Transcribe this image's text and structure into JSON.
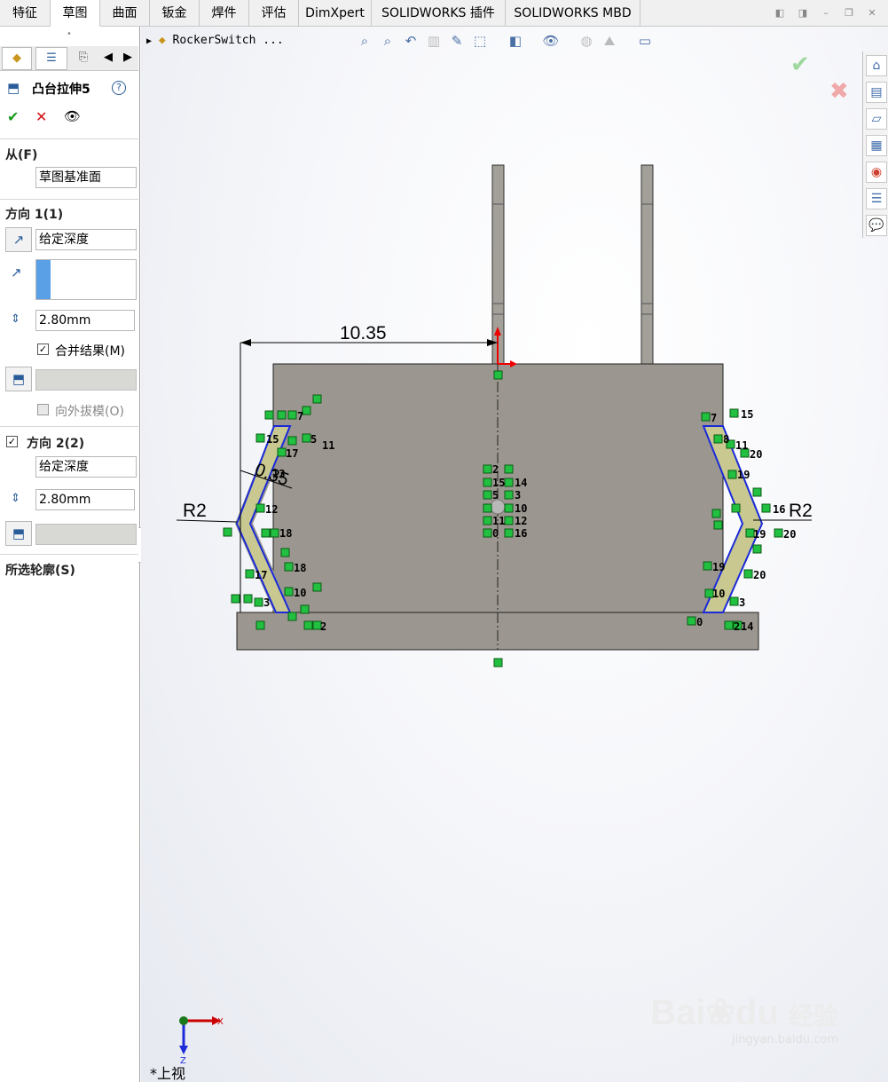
{
  "tabs": [
    {
      "label": "特征",
      "active": false
    },
    {
      "label": "草图",
      "active": true
    },
    {
      "label": "曲面",
      "active": false
    },
    {
      "label": "钣金",
      "active": false
    },
    {
      "label": "焊件",
      "active": false
    },
    {
      "label": "评估",
      "active": false
    },
    {
      "label": "DimXpert",
      "active": false
    },
    {
      "label": "SOLIDWORKS 插件",
      "active": false
    },
    {
      "label": "SOLIDWORKS MBD",
      "active": false
    }
  ],
  "feature": {
    "title": "凸台拉伸5",
    "help_glyph": "?",
    "ok_glyph": "✔",
    "cancel_glyph": "✕",
    "preview_glyph": "👁"
  },
  "from": {
    "title": "从(F)",
    "value": "草图基准面"
  },
  "direction1": {
    "title": "方向 1(1)",
    "end_condition": "给定深度",
    "depth": "2.80mm",
    "merge_label": "合并结果(M)",
    "merge_checked": true,
    "draft_label": "向外拔模(O)",
    "draft_checked": false
  },
  "direction2": {
    "title": "方向 2(2)",
    "checked": true,
    "end_condition": "给定深度",
    "depth": "2.80mm"
  },
  "selected_contours": {
    "title": "所选轮廓(S)"
  },
  "graphics": {
    "breadcrumb": "RockerSwitch  ...",
    "dimension_main": "10.35",
    "dimension_r2_left": "R2",
    "dimension_r2_right": "R2",
    "dimension_angle": "0.35",
    "view_label": "*上视",
    "axis_x": "X",
    "axis_z": "Z",
    "confirm_ok_glyph": "✔",
    "confirm_cancel_glyph": "✖",
    "relation_numbers_center": [
      "2",
      "15",
      "5",
      "11",
      "0",
      "14",
      "3",
      "10",
      "12",
      "16"
    ],
    "relation_numbers_left": [
      "7",
      "15",
      "5",
      "11",
      "17",
      "13",
      "12",
      "18",
      "18",
      "17",
      "10",
      "3",
      "2"
    ],
    "relation_numbers_right": [
      "7",
      "15",
      "8",
      "11",
      "20",
      "19",
      "16",
      "19",
      "20",
      "19",
      "20",
      "10",
      "3",
      "0",
      "2",
      "14"
    ]
  },
  "watermark": {
    "brand": "Bai",
    "brand_tail": "du",
    "cn": "经验",
    "url": "jingyan.baidu.com"
  },
  "colors": {
    "part_fill": "#9b9790",
    "profile_fill": "#c8c890",
    "sketch_line": "#1a2ad8",
    "relation_green": "#22c040",
    "dim_line": "#000000"
  }
}
